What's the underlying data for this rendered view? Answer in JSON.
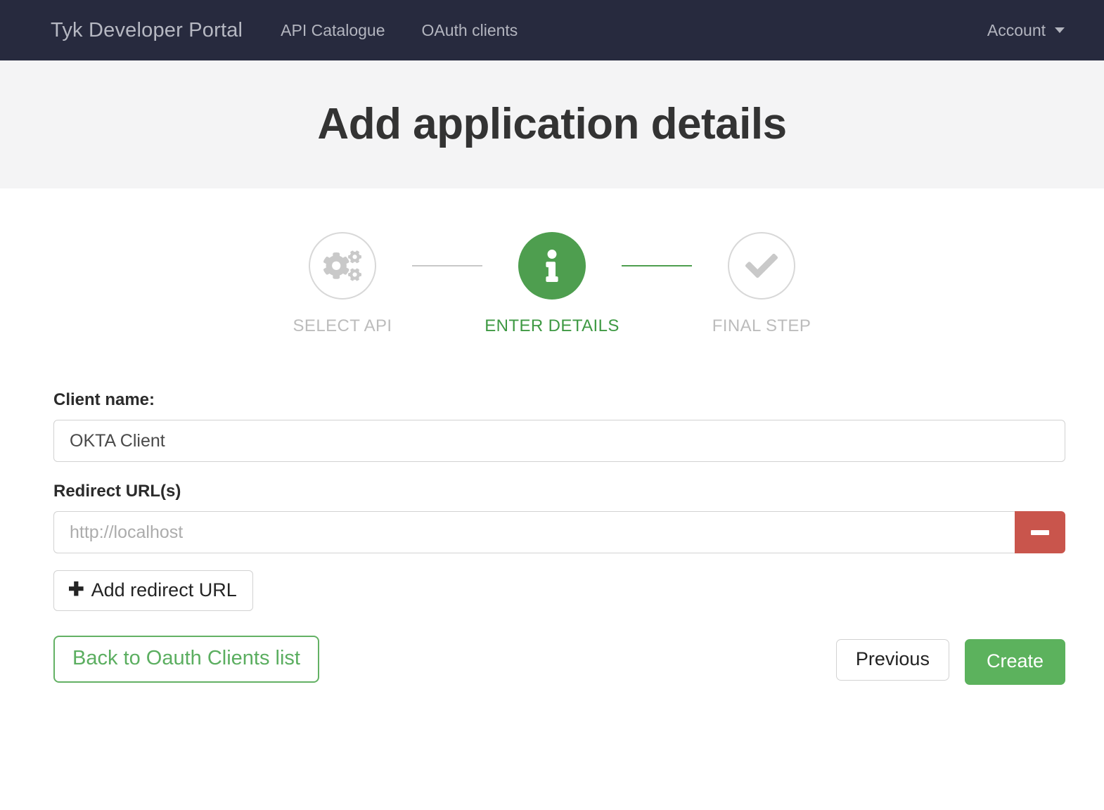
{
  "navbar": {
    "brand": "Tyk Developer Portal",
    "links": [
      {
        "label": "API Catalogue"
      },
      {
        "label": "OAuth clients"
      }
    ],
    "account": {
      "label": "Account",
      "caret_icon": "chevron-down-icon"
    },
    "background_color": "#272a3e",
    "text_color": "#b3b5bf"
  },
  "jumbotron": {
    "title": "Add application details",
    "background_color": "#f4f4f5"
  },
  "wizard": {
    "steps": [
      {
        "label": "Select API",
        "icon": "cogs-icon",
        "state": "inactive"
      },
      {
        "label": "Enter details",
        "icon": "info-icon",
        "state": "active"
      },
      {
        "label": "Final step",
        "icon": "check-icon",
        "state": "inactive"
      }
    ],
    "connectors": [
      {
        "state": "inactive",
        "color": "#c8c8c8"
      },
      {
        "state": "done",
        "color": "#4e9e4f"
      }
    ],
    "active_color": "#3e9943",
    "inactive_color": "#bcbcbc"
  },
  "form": {
    "client_name": {
      "label": "Client name:",
      "value": "OKTA Client",
      "placeholder": ""
    },
    "redirect_urls": {
      "label": "Redirect URL(s)",
      "rows": [
        {
          "value": "",
          "placeholder": "http://localhost",
          "remove_icon": "minus-icon"
        }
      ],
      "add_button": {
        "label": "Add redirect URL",
        "icon": "plus-icon"
      }
    }
  },
  "actions": {
    "back": {
      "label": "Back to Oauth Clients list",
      "color": "#5bae60"
    },
    "previous": {
      "label": "Previous"
    },
    "create": {
      "label": "Create",
      "color": "#5cb25d"
    }
  }
}
